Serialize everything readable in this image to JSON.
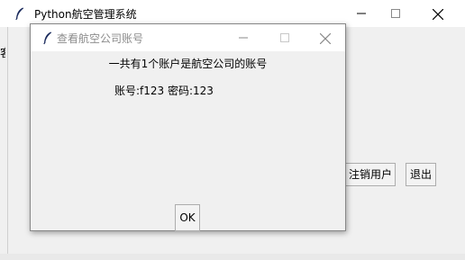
{
  "main_window": {
    "title": "Python航空管理系统",
    "icon": "feather-icon",
    "partial_left_label": "客",
    "buttons": {
      "deregister": "注销用户",
      "exit": "退出"
    }
  },
  "dialog": {
    "title": "查看航空公司账号",
    "icon": "feather-icon",
    "summary": "一共有1个账户是航空公司的账号",
    "accounts": [
      {
        "text": "账号:f123 密码:123"
      }
    ],
    "ok_label": "OK"
  },
  "colors": {
    "titlebar_bg": "#ffffff",
    "window_bg": "#f0f0f0",
    "dialog_title_inactive": "#8c8c8c",
    "button_border": "#adadad"
  }
}
